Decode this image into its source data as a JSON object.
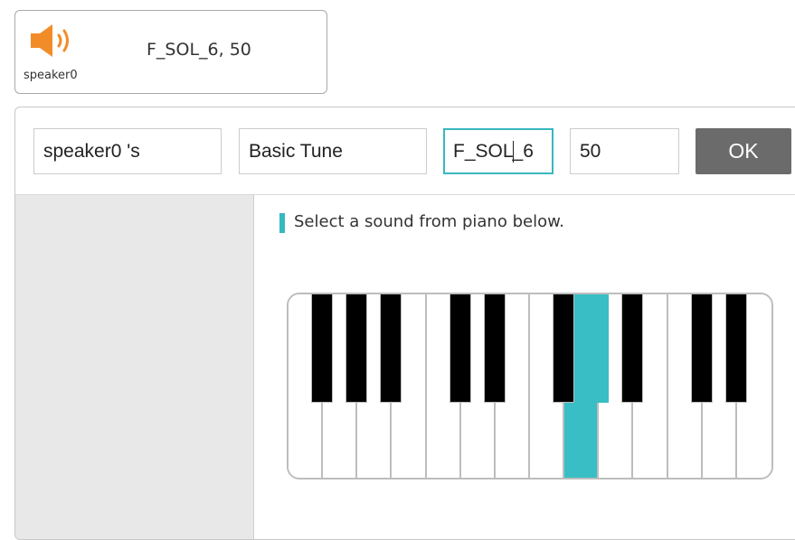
{
  "block": {
    "name": "speaker0",
    "value": "F_SOL_6, 50",
    "icon": "speaker-icon",
    "icon_color": "#f28c28"
  },
  "editor": {
    "target": "speaker0 's",
    "mode": "Basic Tune",
    "note": {
      "before_caret": "F_SOL",
      "after_caret": "_6"
    },
    "duration": "50",
    "ok_label": "OK"
  },
  "hint": "Select a sound from piano below.",
  "piano": {
    "white_keys": 14,
    "black_keys_after_white": [
      0,
      1,
      2,
      4,
      5,
      7,
      8,
      9,
      11,
      12
    ],
    "selected_white_key": 8,
    "selected_black_key_after_white": 8,
    "accent_color": "#38bec4"
  }
}
